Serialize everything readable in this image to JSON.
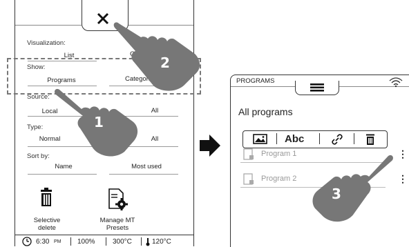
{
  "left_screen": {
    "visualization": {
      "label": "Visualization:",
      "options": [
        "List",
        "Grid"
      ]
    },
    "show": {
      "label": "Show:",
      "options": [
        "Programs",
        "Categories"
      ]
    },
    "source": {
      "label": "Source:",
      "options": [
        "Local",
        "All"
      ]
    },
    "type": {
      "label": "Type:",
      "options": [
        "Normal",
        "All"
      ]
    },
    "sort_by": {
      "label": "Sort by:",
      "options": [
        "Name",
        "Most used"
      ]
    },
    "actions": [
      {
        "label_line1": "Selective",
        "label_line2": "delete",
        "icon": "trash-icon"
      },
      {
        "label_line1": "Manage MT",
        "label_line2": "Presets",
        "icon": "manage-presets-icon"
      }
    ],
    "status_bar": {
      "time": "6:30",
      "ampm": "PM",
      "percent": "100%",
      "temp1": "300°C",
      "temp2": "120°C"
    }
  },
  "right_screen": {
    "header_title": "PROGRAMS",
    "heading": "All programs",
    "toolbar": {
      "text_button": "Abc"
    },
    "programs": [
      "Program 1",
      "Program 2"
    ]
  },
  "steps": [
    "1",
    "2",
    "3"
  ]
}
